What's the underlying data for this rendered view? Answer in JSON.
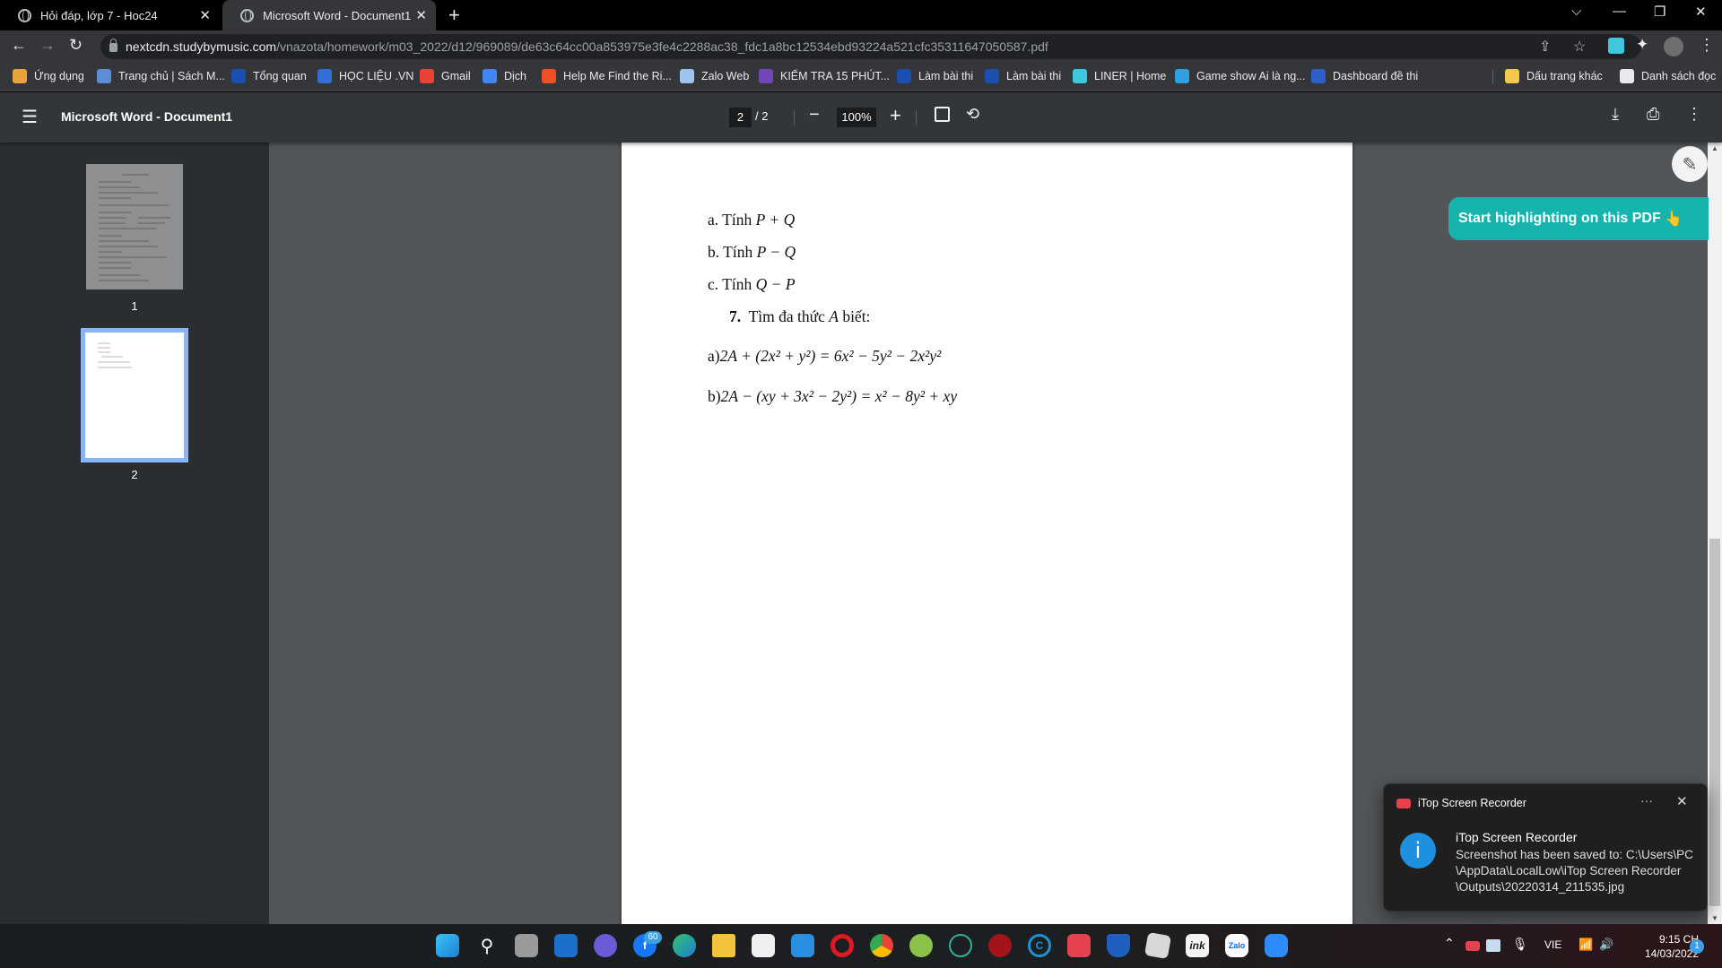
{
  "browser": {
    "tabs": [
      {
        "title": "Hỏi đáp, lớp 7 - Hoc24",
        "active": false
      },
      {
        "title": "Microsoft Word - Document1",
        "active": true
      }
    ],
    "new_tab_symbol": "+",
    "window_controls": {
      "tab_search": "⌵",
      "minimize": "—",
      "restore": "❐",
      "close": "✕"
    },
    "url": {
      "host": "nextcdn.studybymusic.com",
      "path": "/vnazota/homework/m03_2022/d12/969089/de63c64cc00a853975e3fe4c2288ac38_fdc1a8bc12534ebd93224a521cfc35311647050587.pdf"
    },
    "bookmarks": [
      {
        "label": "Ứng dụng",
        "icon": "apps-grid-icon",
        "color": "#e8a33d"
      },
      {
        "label": "Trang chủ | Sách M...",
        "icon": "globe-icon",
        "color": "#5b8dd9"
      },
      {
        "label": "Tổng quan",
        "icon": "k12-icon",
        "color": "#1a4fb0"
      },
      {
        "label": "HỌC LIỆU .VN",
        "icon": "hoclieu-icon",
        "color": "#2f6fd6"
      },
      {
        "label": "Gmail",
        "icon": "gmail-icon",
        "color": "#ea4335"
      },
      {
        "label": "Dịch",
        "icon": "translate-icon",
        "color": "#4285f4"
      },
      {
        "label": "Help Me Find the Ri...",
        "icon": "microsoft-icon",
        "color": "#f25022"
      },
      {
        "label": "Zalo Web",
        "icon": "zalo-icon",
        "color": "#9ec3ee"
      },
      {
        "label": "KIỂM TRA 15 PHÚT...",
        "icon": "forms-icon",
        "color": "#7248b9"
      },
      {
        "label": "Làm bài thi",
        "icon": "k12-icon",
        "color": "#1a4fb0"
      },
      {
        "label": "Làm bài thi",
        "icon": "k12-icon",
        "color": "#1a4fb0"
      },
      {
        "label": "LINER | Home",
        "icon": "liner-icon",
        "color": "#3dc8e0"
      },
      {
        "label": "Game show Ai là ng...",
        "icon": "game-icon",
        "color": "#2f9fe0"
      },
      {
        "label": "Dashboard đề thi",
        "icon": "drive-icon",
        "color": "#2c5fc9"
      },
      {
        "label": "Dấu trang khác",
        "icon": "folder-icon",
        "color": "#f2c94c"
      },
      {
        "label": "Danh sách đọc",
        "icon": "reading-list-icon",
        "color": "#e8eaed"
      }
    ]
  },
  "pdf_viewer": {
    "title": "Microsoft Word - Document1",
    "current_page": "2",
    "page_separator": "/ 2",
    "total_pages": 2,
    "zoom": "100%",
    "thumbnails": [
      {
        "label": "1",
        "selected": false
      },
      {
        "label": "2",
        "selected": true
      }
    ]
  },
  "document": {
    "lines": [
      {
        "prefix": "a. Tính ",
        "math": "P + Q"
      },
      {
        "prefix": "b. Tính ",
        "math": "P − Q"
      },
      {
        "prefix": "c. Tính ",
        "math": "Q − P"
      }
    ],
    "exercise": {
      "number": "7.",
      "text_before": "Tìm đa thức ",
      "var": "A",
      "text_after": " biết:"
    },
    "equations": [
      {
        "label": "a)",
        "expr": "2A + (2x² + y²) = 6x² − 5y² − 2x²y²"
      },
      {
        "label": "b)",
        "expr": "2A − (xy + 3x² − 2y²) = x² − 8y² + xy"
      }
    ]
  },
  "liner": {
    "highlight_button": "Start highlighting on this PDF",
    "emoji": "👆",
    "accent_color": "#17b3ad"
  },
  "notification": {
    "app": "iTop Screen Recorder",
    "title": "iTop Screen Recorder",
    "message_lines": [
      "Screenshot has been saved to: C:\\Users\\PC",
      "\\AppData\\LocalLow\\iTop Screen Recorder",
      "\\Outputs\\20220314_211535.jpg"
    ],
    "more": "···",
    "close": "✕"
  },
  "taskbar": {
    "facebook_badge": "60",
    "tray": {
      "language": "VIE",
      "time": "9:15 CH",
      "date": "14/03/2022",
      "notifications": "1"
    }
  }
}
